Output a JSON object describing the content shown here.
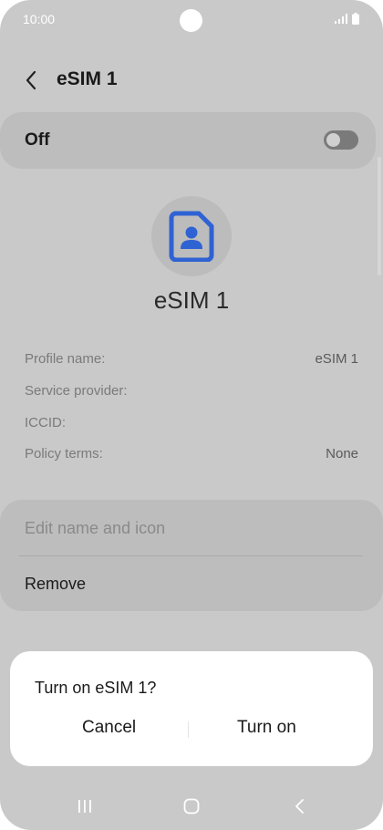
{
  "status_bar": {
    "time": "10:00"
  },
  "header": {
    "title": "eSIM 1"
  },
  "toggle_row": {
    "label": "Off",
    "state": "off"
  },
  "sim": {
    "name": "eSIM 1",
    "icon": "sim-card-person-icon",
    "icon_color": "#2f62d3"
  },
  "info": [
    {
      "label": "Profile name:",
      "value": "eSIM 1"
    },
    {
      "label": "Service provider:",
      "value": ""
    },
    {
      "label": "ICCID:",
      "value": ""
    },
    {
      "label": "Policy terms:",
      "value": "None"
    }
  ],
  "actions": {
    "edit": "Edit name and icon",
    "remove": "Remove"
  },
  "dialog": {
    "title": "Turn on eSIM 1?",
    "cancel": "Cancel",
    "confirm": "Turn on"
  },
  "colors": {
    "background": "#c9c9c9",
    "card": "#bdbdbd",
    "dialog": "#ffffff"
  }
}
